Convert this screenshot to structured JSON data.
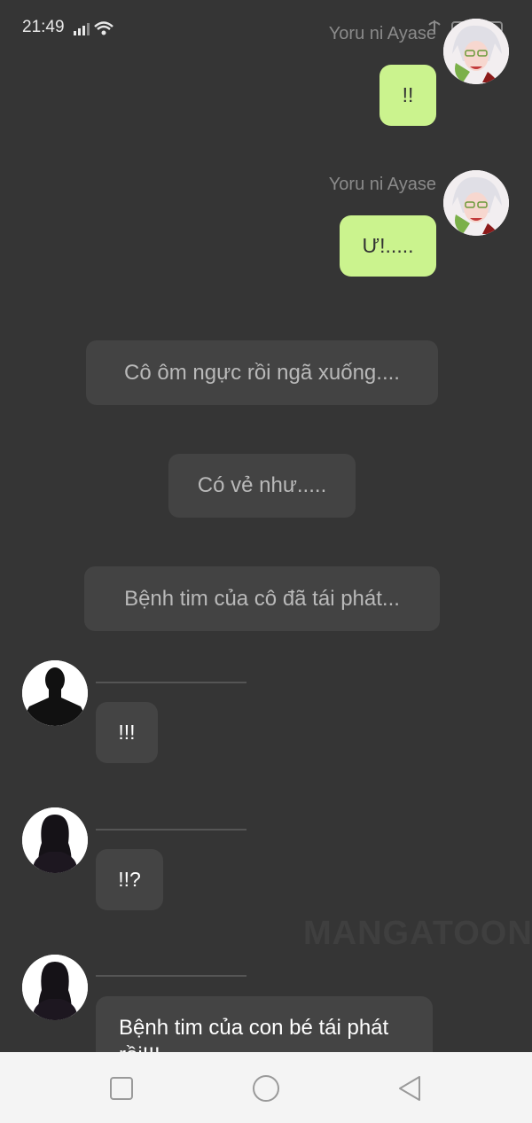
{
  "status_bar": {
    "time": "21:49"
  },
  "messages": {
    "m1": {
      "sender": "Yoru ni Ayase",
      "text": "!!"
    },
    "m2": {
      "sender": "Yoru ni Ayase",
      "text": "Ư!....."
    },
    "narration1": "Cô ôm ngực rồi ngã xuống....",
    "narration2": "Có vẻ như.....",
    "narration3": "Bệnh tim của cô đã tái phát...",
    "m3": {
      "text": "!!!"
    },
    "m4": {
      "text": "!!?"
    },
    "m5": {
      "text": "Bệnh tim của con bé tái phát rồi!!!"
    }
  },
  "watermark": "MANGATOON",
  "colors": {
    "background": "#353535",
    "self_bubble": "#cbf38e",
    "other_bubble": "#444444",
    "narration_bubble": "#434343",
    "nav_bar": "#f4f4f4"
  }
}
